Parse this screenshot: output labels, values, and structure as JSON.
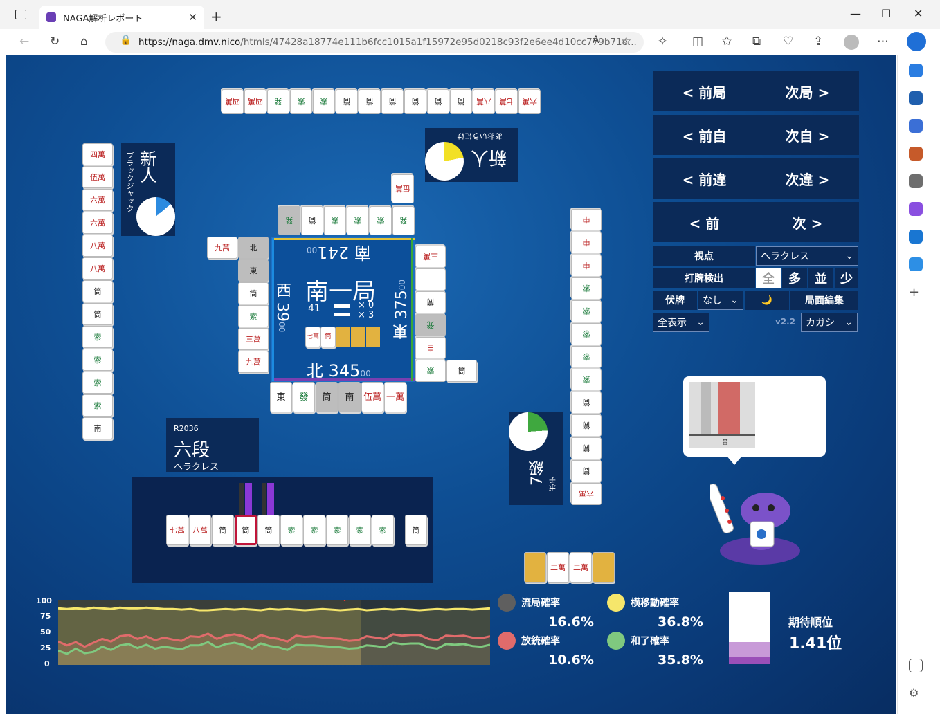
{
  "browser": {
    "tab_title": "NAGA解析レポート",
    "url_host": "https://naga.dmv.nico",
    "url_path": "/htmls/47428a18774e111b6fcc1015a1f15972e95d0218c93f2e6ee4d10cc779b71e..."
  },
  "nav": {
    "prev_round": "< 前局",
    "next_round": "次局 >",
    "prev_self": "< 前自",
    "next_self": "次自 >",
    "prev_diff": "< 前違",
    "next_diff": "次違 >",
    "prev": "< 前",
    "next": "次 >"
  },
  "controls": {
    "viewpoint_label": "視点",
    "viewpoint_value": "ヘラクレス",
    "detect_label": "打牌検出",
    "detect_opts": [
      "全",
      "多",
      "並",
      "少"
    ],
    "hide_label": "伏牌",
    "hide_value": "なし",
    "moon": "🌙",
    "edit_label": "局面編集",
    "display_value": "全表示",
    "version": "v2.2",
    "model_value": "カガシ"
  },
  "center": {
    "round": "南一局",
    "honba": "41",
    "stick1": "× 0",
    "stick2": "× 3",
    "south_score": "南 241",
    "south_sub": "00",
    "west_score": "西 39",
    "west_sub": "00",
    "east_score": "東 375",
    "east_sub": "00",
    "north_score": "北 345",
    "north_sub": "00"
  },
  "players": {
    "top": {
      "rank": "新人",
      "name": "あおいうにけ"
    },
    "left": {
      "rank": "新人",
      "name": "ブラックジャック"
    },
    "right": {
      "rank": "7級",
      "name": "ポチ"
    },
    "self": {
      "rating": "R2036",
      "rank": "六段",
      "name": "ヘラクレス"
    }
  },
  "tiles": {
    "top_river": [
      "四萬",
      "四萬",
      "発",
      "索",
      "索",
      "筒",
      "筒",
      "筒",
      "筒",
      "筒",
      "筒",
      "八萬",
      "七萬",
      "六萬"
    ],
    "left_river": [
      "四萬",
      "伍萬",
      "六萬",
      "六萬",
      "八萬",
      "八萬",
      "筒",
      "筒",
      "索",
      "索",
      "索",
      "索",
      "南"
    ],
    "right_river": [
      "中",
      "中",
      "中",
      "索",
      "索",
      "索",
      "索",
      "索",
      "筒",
      "筒",
      "筒",
      "筒",
      "六萬"
    ],
    "self_hand": [
      "七萬",
      "八萬",
      "筒",
      "筒",
      "筒",
      "索",
      "索",
      "索",
      "索",
      "索",
      "筒"
    ],
    "bottom_meld": [
      "二萬",
      "二萬"
    ],
    "north_wall": [
      "東",
      "發",
      "筒",
      "南",
      "伍萬",
      "一萬"
    ]
  },
  "ai_bubble": {
    "label": "音"
  },
  "chart": {
    "yticks": [
      "100",
      "75",
      "50",
      "25",
      "0"
    ]
  },
  "stats": {
    "ryukyoku_label": "流局確率",
    "ryukyoku_val": "16.6%",
    "yoko_label": "横移動確率",
    "yoko_val": "36.8%",
    "houju_label": "放銃確率",
    "houju_val": "10.6%",
    "hora_label": "和了確率",
    "hora_val": "35.8%",
    "expect_label": "期待順位",
    "expect_val": "1.41位"
  },
  "colors": {
    "ryukyoku": "#5f5f5f",
    "yoko": "#f6e66b",
    "houju": "#e06b6b",
    "hora": "#7fc97f",
    "board": "#0e4e93",
    "panel": "#0b2a58"
  },
  "chart_data": {
    "type": "line",
    "ylim": [
      0,
      100
    ],
    "yticks": [
      100,
      75,
      50,
      25,
      0
    ],
    "series": [
      {
        "values": [
          87,
          86,
          87,
          86,
          88,
          87,
          86,
          88,
          87,
          87,
          88,
          87,
          86,
          86,
          85,
          86,
          84,
          84,
          85,
          86,
          85,
          86,
          85,
          84,
          86,
          85,
          86,
          85,
          84,
          85,
          86,
          85,
          84,
          85,
          86,
          84,
          85,
          86,
          85,
          86,
          85,
          84,
          85,
          86,
          85,
          86,
          86,
          85,
          86,
          87
        ]
      },
      {
        "values": [
          36,
          30,
          35,
          28,
          34,
          40,
          36,
          44,
          46,
          40,
          44,
          38,
          42,
          39,
          37,
          44,
          43,
          48,
          40,
          45,
          47,
          44,
          38,
          46,
          42,
          40,
          36,
          45,
          43,
          44,
          42,
          41,
          40,
          37,
          38,
          44,
          42,
          40,
          47,
          45,
          46,
          46,
          40,
          38,
          45,
          44,
          45,
          42,
          41,
          44
        ]
      },
      {
        "values": [
          22,
          17,
          25,
          18,
          20,
          28,
          23,
          30,
          32,
          26,
          31,
          25,
          28,
          26,
          24,
          30,
          30,
          35,
          27,
          32,
          34,
          31,
          25,
          33,
          29,
          27,
          23,
          31,
          30,
          30,
          29,
          28,
          27,
          25,
          26,
          30,
          29,
          27,
          34,
          32,
          33,
          33,
          27,
          25,
          32,
          31,
          32,
          29,
          28,
          31
        ]
      }
    ]
  }
}
